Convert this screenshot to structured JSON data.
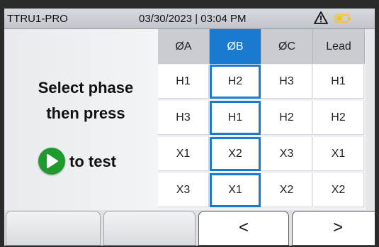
{
  "status_bar": {
    "device_name": "TTRU1-PRO",
    "datetime": "03/30/2023 | 03:04 PM",
    "warning_icon": "warning-triangle-icon",
    "battery_icon": "battery-icon",
    "battery_color": "#f5c518"
  },
  "instructions": {
    "line1": "Select phase",
    "line2": "then press",
    "line3": "to test",
    "play_icon": "play-icon",
    "play_color": "#1f9a2c"
  },
  "table": {
    "headers": [
      "ØA",
      "ØB",
      "ØC",
      "Lead"
    ],
    "selected_column": "ØB",
    "rows": [
      [
        "H1",
        "H2",
        "H3",
        "H1"
      ],
      [
        "H3",
        "H1",
        "H2",
        "H2"
      ],
      [
        "X1",
        "X2",
        "X3",
        "X1"
      ],
      [
        "X3",
        "X1",
        "X2",
        "X2"
      ]
    ],
    "accent_color": "#1a7ad0"
  },
  "softkeys": {
    "key1": "",
    "key2": "",
    "prev": "<",
    "next": ">"
  }
}
